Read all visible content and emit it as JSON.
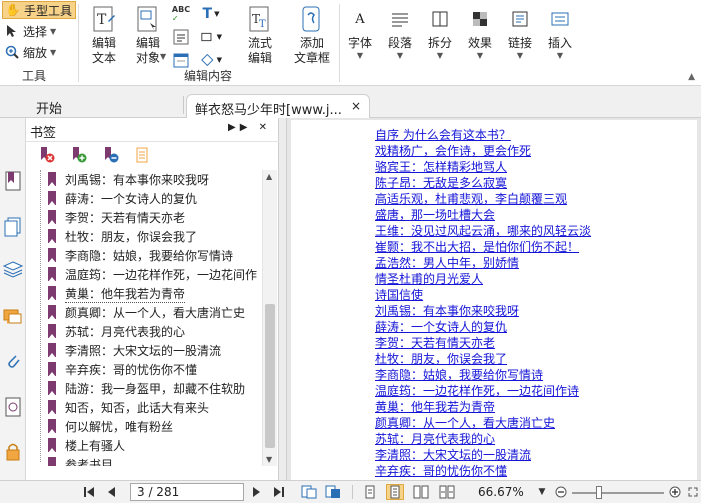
{
  "ribbon": {
    "tools_group": {
      "hand_tool": "手型工具",
      "select": "选择",
      "zoom": "缩放",
      "label": "工具"
    },
    "edit_group": {
      "edit_text": "编辑\n文本",
      "edit_object": "编辑\n对象",
      "flow_edit": "流式\n编辑",
      "add_textbox": "添加\n文章框",
      "label": "编辑内容"
    },
    "more_buttons": [
      {
        "label": "字体",
        "icon": "font-icon"
      },
      {
        "label": "段落",
        "icon": "paragraph-icon"
      },
      {
        "label": "拆分",
        "icon": "split-icon"
      },
      {
        "label": "效果",
        "icon": "effect-icon"
      },
      {
        "label": "链接",
        "icon": "link-icon"
      },
      {
        "label": "插入",
        "icon": "insert-icon"
      }
    ]
  },
  "tabs": {
    "home": "开始",
    "document": "鲜衣怒马少年时[www.j...",
    "close": "×"
  },
  "bookmarks": {
    "title": "书签",
    "items": [
      "刘禹锡：有本事你来咬我呀",
      "薛涛：一个女诗人的复仇",
      "李贺：天若有情天亦老",
      "杜牧：朋友，你误会我了",
      "李商隐：姑娘，我要给你写情诗",
      "温庭筠：一边花样作死，一边花间作",
      "黄巢：他年我若为青帝",
      "颜真卿：从一个人，看大唐消亡史",
      "苏轼：月亮代表我的心",
      "李清照：大宋文坛的一股清流",
      "辛弃疾：哥的忧伤你不懂",
      "陆游：我一身盔甲，却藏不住软肋",
      "知否，知否，此话大有来头",
      "何以解忧，唯有粉丝",
      "楼上有骚人",
      "参考书目"
    ]
  },
  "toc": [
    "自序 为什么会有这本书？",
    "戏精杨广，会作诗，更会作死",
    "骆宾王：怎样精彩地骂人",
    "陈子昂：无敌是多么寂寞",
    "高适乐观，杜甫悲观，李白颠覆三观",
    "盛唐，那一场吐槽大会",
    "王维：没见过风起云涌，哪来的风轻云淡",
    "崔颢：我不出大招，是怕你们伤不起！",
    "孟浩然：男人中年，别娇情",
    "情圣杜甫的月光爱人",
    "诗国信使",
    "刘禹锡：有本事你来咬我呀",
    "薛涛：一个女诗人的复仇",
    "李贺：天若有情天亦老",
    "杜牧：朋友，你误会我了",
    "李商隐：姑娘，我要给你写情诗",
    "温庭筠：一边花样作死，一边花间作诗",
    "黄巢：他年我若为青帝",
    "颜真卿：从一个人，看大唐消亡史",
    "苏轼：月亮代表我的心",
    "李清照：大宋文坛的一股清流",
    "辛弃疾：哥的忧伤你不懂"
  ],
  "statusbar": {
    "page_indicator": "3 / 281",
    "zoom": "66.67%"
  },
  "colors": {
    "link": "#1515d8",
    "bookmark_flag": "#7c3a6f",
    "active_tool": "#f7d38a"
  }
}
